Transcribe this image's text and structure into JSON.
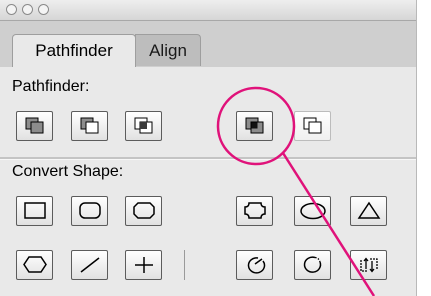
{
  "tabs": [
    {
      "label": "Pathfinder",
      "active": true
    },
    {
      "label": "Align",
      "active": false
    }
  ],
  "sections": {
    "pathfinder": {
      "label": "Pathfinder:"
    },
    "convert_shape": {
      "label": "Convert Shape:"
    }
  },
  "pathfinder_buttons": [
    "unite-icon",
    "minus-front-icon",
    "intersect-icon",
    "exclude-icon",
    "minus-back-icon"
  ],
  "convert_row1": [
    "rectangle-icon",
    "rounded-rectangle-icon",
    "beveled-rectangle-icon",
    "inverse-rounded-rectangle-icon",
    "ellipse-icon",
    "triangle-icon"
  ],
  "convert_row2": [
    "polygon-icon",
    "line-icon",
    "plus-icon",
    "open-path-icon",
    "close-path-icon",
    "reverse-path-icon"
  ],
  "annotation": {
    "color": "#e0127a",
    "highlighted": "exclude-button"
  }
}
